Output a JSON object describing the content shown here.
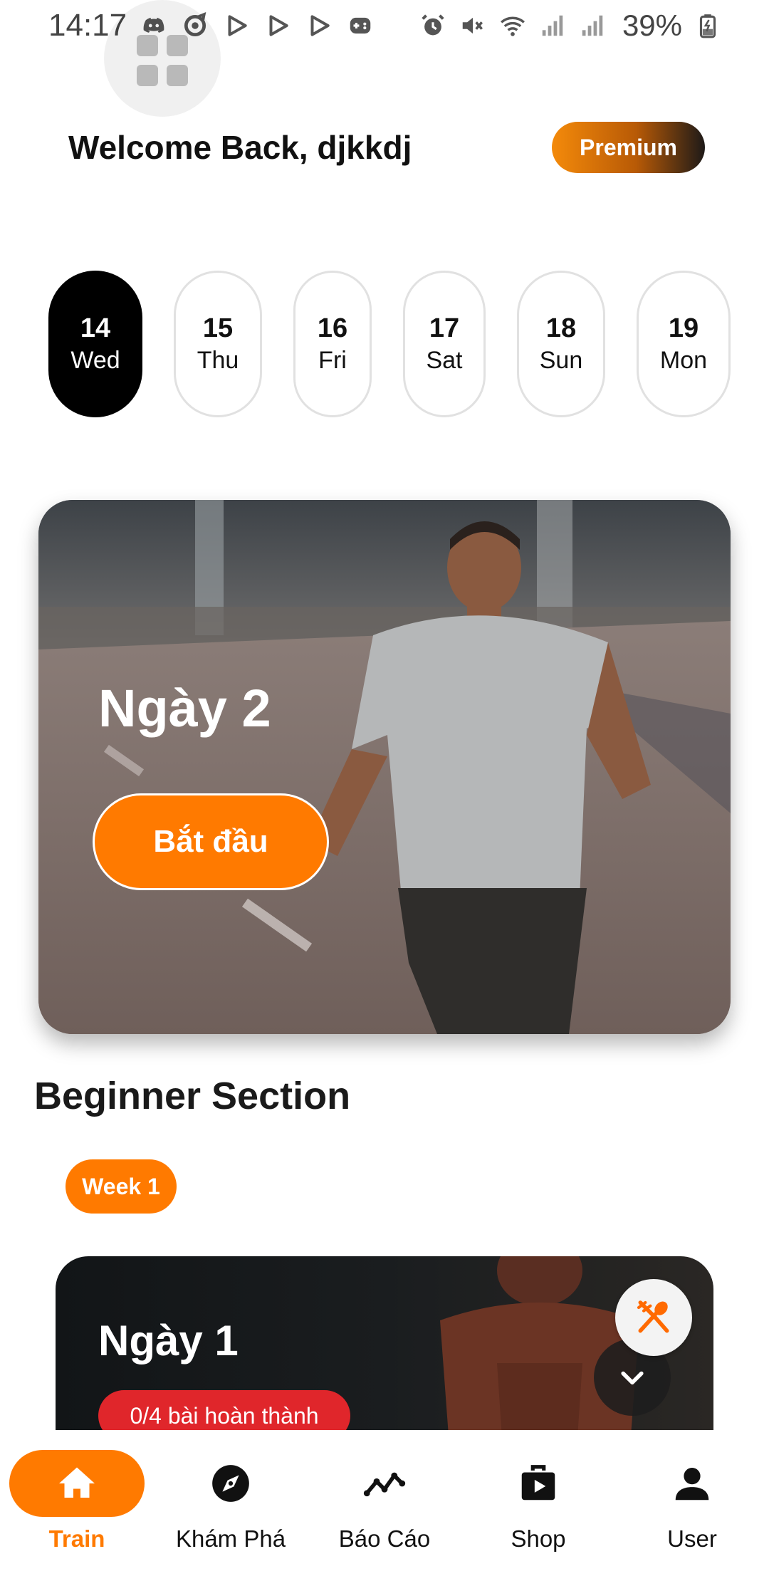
{
  "status_bar": {
    "time": "14:17",
    "battery": "39%",
    "left_icons": [
      "discord-icon",
      "sync-icon",
      "play-icon",
      "play-icon",
      "play-icon",
      "gamepad-icon"
    ],
    "right_icons": [
      "alarm-icon",
      "mute-icon",
      "wifi-icon",
      "signal-icon",
      "signal-icon",
      "battery-icon"
    ]
  },
  "header": {
    "welcome": "Welcome Back, djkkdj",
    "premium_label": "Premium"
  },
  "days": [
    {
      "num": "14",
      "dow": "Wed",
      "active": true
    },
    {
      "num": "15",
      "dow": "Thu",
      "active": false
    },
    {
      "num": "16",
      "dow": "Fri",
      "active": false
    },
    {
      "num": "17",
      "dow": "Sat",
      "active": false
    },
    {
      "num": "18",
      "dow": "Sun",
      "active": false
    },
    {
      "num": "19",
      "dow": "Mon",
      "active": false
    }
  ],
  "hero": {
    "title": "Ngày 2",
    "start_label": "Bắt đầu"
  },
  "section": {
    "title": "Beginner Section",
    "week_label": "Week 1",
    "card": {
      "title": "Ngày 1",
      "progress": "0/4 bài hoàn thành"
    }
  },
  "nav": [
    {
      "label": "Train",
      "icon": "home-icon",
      "active": true
    },
    {
      "label": "Khám Phá",
      "icon": "compass-icon",
      "active": false
    },
    {
      "label": "Báo Cáo",
      "icon": "chart-icon",
      "active": false
    },
    {
      "label": "Shop",
      "icon": "shop-icon",
      "active": false
    },
    {
      "label": "User",
      "icon": "user-icon",
      "active": false
    }
  ],
  "colors": {
    "accent": "#ff7a00",
    "badge_red": "#e0262b",
    "active_day": "#000000"
  }
}
